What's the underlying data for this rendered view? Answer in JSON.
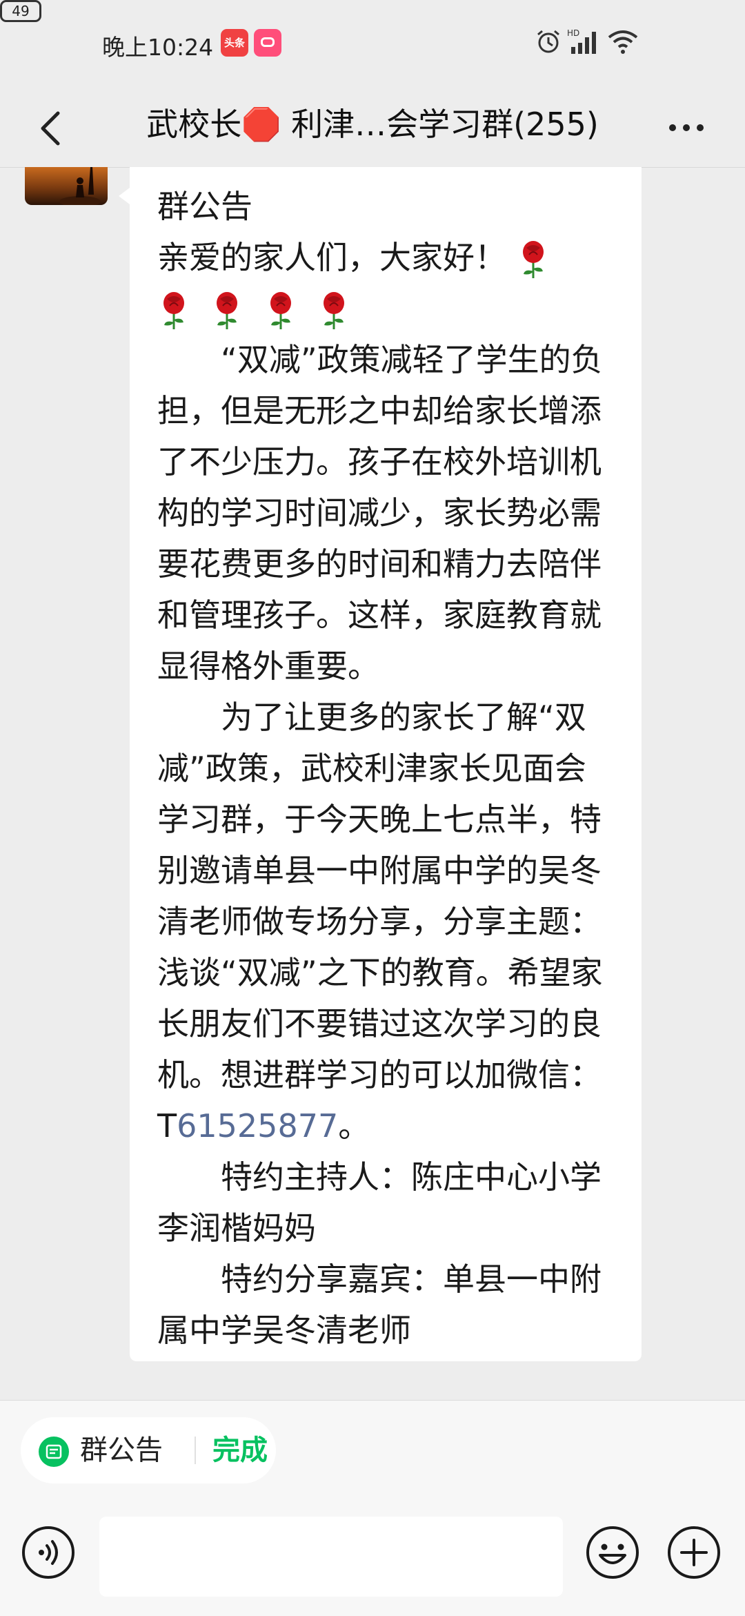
{
  "status_bar": {
    "time": "晚上10:24",
    "badge_app": "头条",
    "battery": "49"
  },
  "nav": {
    "title": "武校长🛑 利津…会学习群(255)"
  },
  "message": {
    "title": "群公告",
    "greeting": "亲爱的家人们，大家好！",
    "p1": "“双减”政策减轻了学生的负担，但是无形之中却给家长增添了不少压力。孩子在校外培训机构的学习时间减少，家长势必需要花费更多的时间和精力去陪伴和管理孩子。这样，家庭教育就显得格外重要。",
    "p2_before_id": "为了让更多的家长了解“双减”政策，武校利津家长见面会学习群，于今天晚上七点半，特别邀请单县一中附属中学的吴冬清老师做专场分享，分享主题：浅谈“双减”之下的教育。希望家长朋友们不要错过这次学习的良机。想进群学习的可以加微信：T",
    "wechat_id": "61525877",
    "p2_after_id": "。",
    "p3": "特约主持人：陈庄中心小学李润楷妈妈",
    "p4": "特约分享嘉宾：单县一中附属中学吴冬清老师"
  },
  "bottom_bar": {
    "notice_label": "群公告",
    "done_label": "完成"
  },
  "colors": {
    "accent_green": "#07c160",
    "link_blue": "#576b95",
    "background": "#ededed"
  }
}
